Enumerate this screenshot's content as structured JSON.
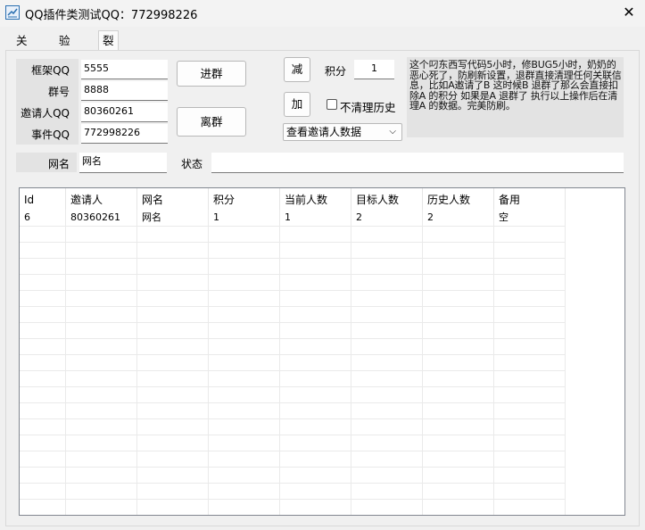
{
  "window": {
    "title": "QQ插件类测试QQ：772998226",
    "close_label": "✕"
  },
  "tabs": [
    {
      "label": "关键词"
    },
    {
      "label": "验证码"
    },
    {
      "label": "裂变"
    }
  ],
  "form": {
    "frame_qq_label": "框架QQ",
    "frame_qq_value": "5555",
    "group_label": "群号",
    "group_value": "8888",
    "inviter_qq_label": "邀请人QQ",
    "inviter_qq_value": "80360261",
    "event_qq_label": "事件QQ",
    "event_qq_value": "772998226",
    "nickname_label": "网名",
    "nickname_value": "网名",
    "status_label": "状态",
    "status_value": ""
  },
  "buttons": {
    "join": "进群",
    "leave": "离群",
    "minus": "减",
    "plus": "加"
  },
  "points": {
    "label": "积分",
    "value": "1"
  },
  "no_clear_history": {
    "label": "不清理历史",
    "checked": false
  },
  "view_select": {
    "value": "查看邀请人数据"
  },
  "note_text": "这个叼东西写代码5小时，修BUG5小时，奶奶的恶心死了，防刷新设置，退群直接清理任何关联信息，比如A邀请了B 这时候B 退群了那么会直接扣除A 的积分 如果是A 退群了 执行以上操作后在清理A 的数据。完美防刷。",
  "table": {
    "columns": [
      "Id",
      "邀请人",
      "网名",
      "积分",
      "当前人数",
      "目标人数",
      "历史人数",
      "备用"
    ],
    "rows": [
      [
        "6",
        "80360261",
        "网名",
        "1",
        "1",
        "2",
        "2",
        "空"
      ]
    ]
  }
}
